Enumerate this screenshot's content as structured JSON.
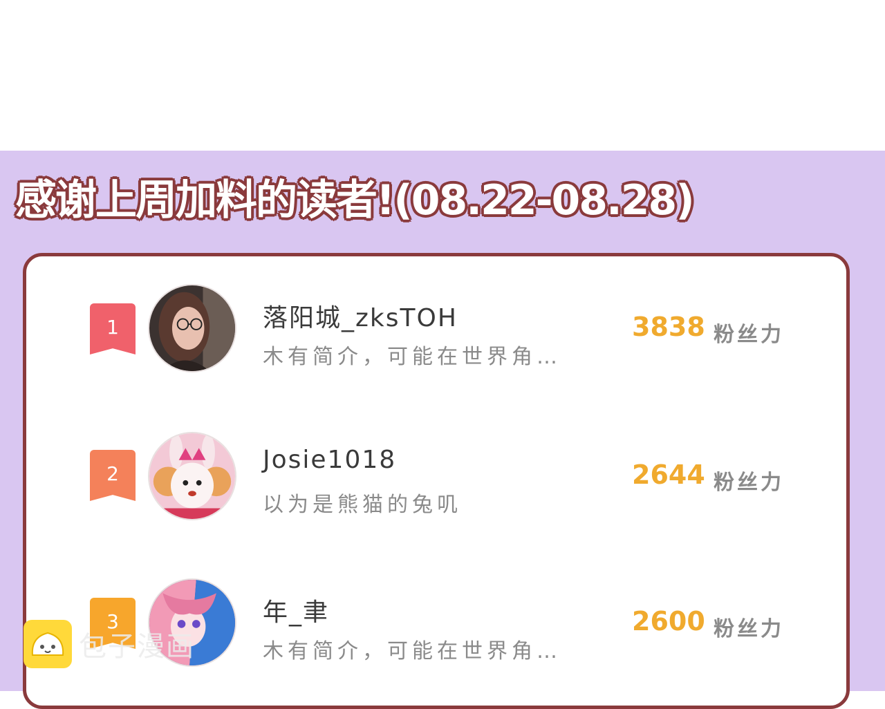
{
  "title": "感谢上周加料的读者!(08.22-08.28)",
  "colors": {
    "panel_bg": "#d9c6f1",
    "card_border": "#8a3a3c",
    "score": "#f0aa2e",
    "rank1": "#f0616b",
    "rank2": "#f4815a",
    "rank3": "#f7a62c"
  },
  "rows": [
    {
      "rank": "1",
      "name": "落阳城_zksTOH",
      "bio": "木有简介，可能在世界角…",
      "score": "3838",
      "unit": "粉丝力",
      "avatar": "girl-with-glasses-avatar"
    },
    {
      "rank": "2",
      "name": "Josie1018",
      "bio": "以为是熊猫的兔叽",
      "score": "2644",
      "unit": "粉丝力",
      "avatar": "bunny-plush-avatar"
    },
    {
      "rank": "3",
      "name": "年_聿",
      "bio": "木有简介，可能在世界角…",
      "score": "2600",
      "unit": "粉丝力",
      "avatar": "anime-pink-hair-avatar"
    }
  ],
  "watermark": {
    "text": "包子漫画",
    "icon": "bun-logo-icon"
  }
}
